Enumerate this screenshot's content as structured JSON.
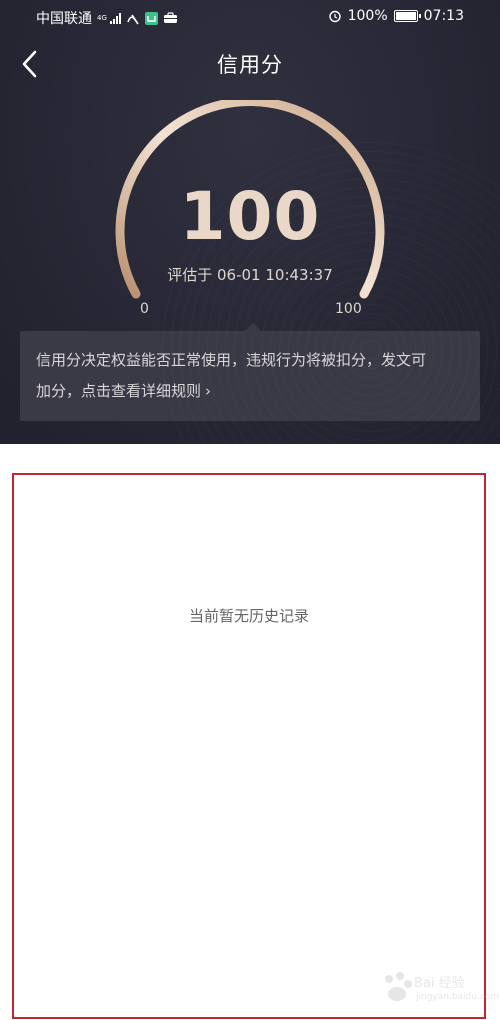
{
  "status_bar": {
    "carrier": "中国联通",
    "network_type": "4G",
    "battery_percent": "100%",
    "time": "07:13"
  },
  "nav": {
    "title": "信用分"
  },
  "credit": {
    "score": "100",
    "evaluated_at": "评估于 06-01 10:43:37",
    "gauge_min": "0",
    "gauge_max": "100",
    "level_fraction": 1.0
  },
  "info_card": {
    "line1": "信用分决定权益能否正常使用，违规行为将被扣分，发文可",
    "line2": "加分，点击查看详细规则",
    "chevron": "›"
  },
  "history": {
    "empty_text": "当前暂无历史记录"
  },
  "watermark": {
    "brand": "Bai 经验",
    "url": "jingyan.baidu.com"
  },
  "colors": {
    "panel_dark": "#272735",
    "gauge_gold": "#d9b99a",
    "score_text": "#e9d8c8",
    "card_bg": "#3a3a47",
    "highlight_border": "#c4262e"
  },
  "icons": [
    "signal-icon",
    "mihome-icon",
    "briefcase-icon",
    "alarm-icon",
    "battery-icon",
    "back-arrow-icon",
    "chevron-right-icon"
  ]
}
